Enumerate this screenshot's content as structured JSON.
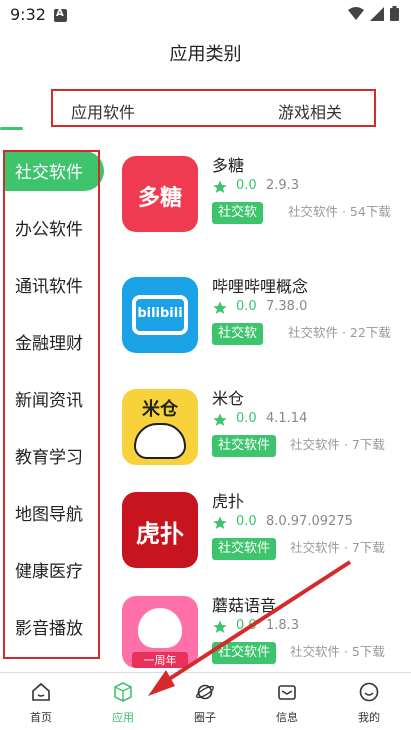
{
  "status": {
    "time": "9:32"
  },
  "header": {
    "title": "应用类别"
  },
  "top_tabs": [
    {
      "label": "应用软件"
    },
    {
      "label": "游戏相关"
    }
  ],
  "sidebar": {
    "items": [
      {
        "label": "社交软件",
        "active": true
      },
      {
        "label": "办公软件"
      },
      {
        "label": "通讯软件"
      },
      {
        "label": "金融理财"
      },
      {
        "label": "新闻资讯"
      },
      {
        "label": "教育学习"
      },
      {
        "label": "地图导航"
      },
      {
        "label": "健康医疗"
      },
      {
        "label": "影音播放"
      }
    ]
  },
  "apps": [
    {
      "name": "多糖",
      "rating": "0.0",
      "version": "2.9.3",
      "tag": "社交软",
      "desc": "社交软件 · 54下载",
      "icon_text": "多糖"
    },
    {
      "name": "哔哩哔哩概念",
      "rating": "0.0",
      "version": "7.38.0",
      "tag": "社交软",
      "desc": "社交软件 · 22下载",
      "icon_text": "bilibili"
    },
    {
      "name": "米仓",
      "rating": "0.0",
      "version": "4.1.14",
      "tag": "社交软件",
      "desc": "社交软件 · 7下载",
      "icon_text": "米仓"
    },
    {
      "name": "虎扑",
      "rating": "0.0",
      "version": "8.0.97.09275",
      "tag": "社交软件",
      "desc": "社交软件 · 7下载",
      "icon_text": "虎扑"
    },
    {
      "name": "蘑菇语音",
      "rating": "0.0",
      "version": "1.8.3",
      "tag": "社交软件",
      "desc": "社交软件 · 5下载",
      "icon_text": "一周年"
    }
  ],
  "bottom_nav": [
    {
      "label": "首页",
      "icon": "home-icon"
    },
    {
      "label": "应用",
      "icon": "cube-icon",
      "active": true
    },
    {
      "label": "圈子",
      "icon": "planet-icon"
    },
    {
      "label": "信息",
      "icon": "mail-icon"
    },
    {
      "label": "我的",
      "icon": "smile-icon"
    }
  ],
  "colors": {
    "accent": "#3ec46d",
    "annotation": "#d42a2a"
  }
}
